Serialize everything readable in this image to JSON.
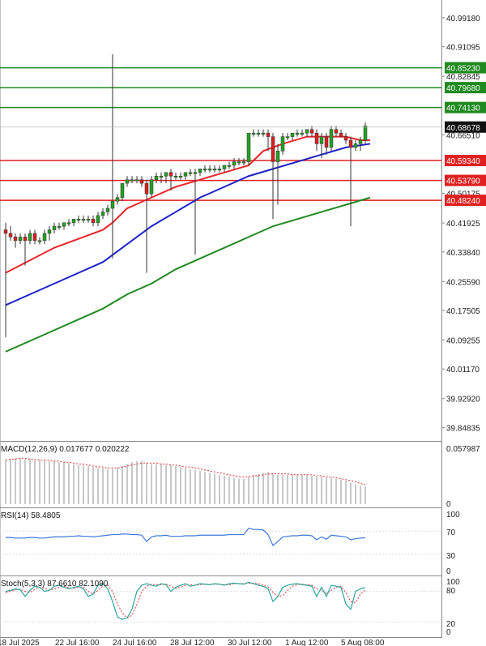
{
  "chart_data": {
    "type": "candlestick",
    "price_axis": {
      "ticks": [
        "40.99180",
        "40.91095",
        "40.82845",
        "40.66510",
        "40.50175",
        "40.41925",
        "40.33840",
        "40.25590",
        "40.17505",
        "40.09255",
        "40.01170",
        "39.92920",
        "39.84835"
      ],
      "ylim": [
        39.82,
        41.03
      ]
    },
    "current_price": "40.68678",
    "x_axis": {
      "labels": [
        "18 Jul 2025",
        "22 Jul 16:00",
        "24 Jul 16:00",
        "28 Jul 12:00",
        "30 Jul 12:00",
        "1 Aug 12:00",
        "5 Aug 08:00"
      ]
    },
    "levels": {
      "resistance": [
        40.8523,
        40.7968,
        40.7413
      ],
      "support": [
        40.5934,
        40.5379,
        40.4824
      ],
      "resistance_labels": [
        "40.85230",
        "40.79680",
        "40.74130"
      ],
      "support_labels": [
        "40.59340",
        "40.53790",
        "40.48240"
      ],
      "resistance_color": "#1f8a1f",
      "support_color": "#e02020"
    },
    "candles": [
      [
        40.4,
        40.42,
        40.1,
        40.39
      ],
      [
        40.39,
        40.41,
        40.37,
        40.38
      ],
      [
        40.38,
        40.39,
        40.35,
        40.37
      ],
      [
        40.37,
        40.39,
        40.36,
        40.38
      ],
      [
        40.38,
        40.39,
        40.3,
        40.37
      ],
      [
        40.37,
        40.4,
        40.36,
        40.39
      ],
      [
        40.39,
        40.4,
        40.36,
        40.37
      ],
      [
        40.37,
        40.38,
        40.36,
        40.37
      ],
      [
        40.37,
        40.4,
        40.36,
        40.39
      ],
      [
        40.39,
        40.41,
        40.37,
        40.4
      ],
      [
        40.4,
        40.42,
        40.39,
        40.41
      ],
      [
        40.41,
        40.42,
        40.4,
        40.41
      ],
      [
        40.41,
        40.42,
        40.4,
        40.42
      ],
      [
        40.42,
        40.43,
        40.41,
        40.42
      ],
      [
        40.42,
        40.43,
        40.41,
        40.43
      ],
      [
        40.43,
        40.44,
        40.42,
        40.43
      ],
      [
        40.43,
        40.44,
        40.42,
        40.43
      ],
      [
        40.43,
        40.44,
        40.42,
        40.43
      ],
      [
        40.43,
        40.44,
        40.41,
        40.42
      ],
      [
        40.42,
        40.45,
        40.41,
        40.44
      ],
      [
        40.44,
        40.46,
        40.43,
        40.45
      ],
      [
        40.45,
        40.47,
        40.44,
        40.46
      ],
      [
        40.46,
        40.89,
        40.32,
        40.48
      ],
      [
        40.48,
        40.5,
        40.47,
        40.49
      ],
      [
        40.49,
        40.53,
        40.48,
        40.53
      ],
      [
        40.53,
        40.55,
        40.52,
        40.54
      ],
      [
        40.54,
        40.55,
        40.53,
        40.54
      ],
      [
        40.54,
        40.55,
        40.53,
        40.54
      ],
      [
        40.54,
        40.55,
        40.52,
        40.53
      ],
      [
        40.53,
        40.54,
        40.28,
        40.5
      ],
      [
        40.5,
        40.55,
        40.49,
        40.54
      ],
      [
        40.54,
        40.56,
        40.53,
        40.55
      ],
      [
        40.55,
        40.56,
        40.53,
        40.55
      ],
      [
        40.55,
        40.56,
        40.53,
        40.56
      ],
      [
        40.56,
        40.57,
        40.51,
        40.55
      ],
      [
        40.55,
        40.56,
        40.54,
        40.55
      ],
      [
        40.55,
        40.56,
        40.54,
        40.55
      ],
      [
        40.55,
        40.56,
        40.54,
        40.56
      ],
      [
        40.56,
        40.57,
        40.55,
        40.56
      ],
      [
        40.56,
        40.57,
        40.33,
        40.56
      ],
      [
        40.56,
        40.57,
        40.55,
        40.57
      ],
      [
        40.57,
        40.58,
        40.56,
        40.57
      ],
      [
        40.57,
        40.58,
        40.56,
        40.57
      ],
      [
        40.57,
        40.58,
        40.56,
        40.57
      ],
      [
        40.57,
        40.58,
        40.56,
        40.57
      ],
      [
        40.57,
        40.58,
        40.56,
        40.58
      ],
      [
        40.58,
        40.59,
        40.57,
        40.58
      ],
      [
        40.58,
        40.6,
        40.57,
        40.59
      ],
      [
        40.59,
        40.6,
        40.58,
        40.59
      ],
      [
        40.59,
        40.6,
        40.58,
        40.59
      ],
      [
        40.59,
        40.67,
        40.58,
        40.67
      ],
      [
        40.67,
        40.68,
        40.66,
        40.67
      ],
      [
        40.67,
        40.68,
        40.66,
        40.67
      ],
      [
        40.67,
        40.68,
        40.66,
        40.67
      ],
      [
        40.67,
        40.68,
        40.62,
        40.66
      ],
      [
        40.66,
        40.67,
        40.43,
        40.59
      ],
      [
        40.59,
        40.64,
        40.47,
        40.62
      ],
      [
        40.62,
        40.67,
        40.61,
        40.66
      ],
      [
        40.66,
        40.67,
        40.65,
        40.66
      ],
      [
        40.66,
        40.67,
        40.65,
        40.67
      ],
      [
        40.67,
        40.68,
        40.66,
        40.67
      ],
      [
        40.67,
        40.68,
        40.66,
        40.67
      ],
      [
        40.67,
        40.68,
        40.66,
        40.68
      ],
      [
        40.68,
        40.69,
        40.66,
        40.67
      ],
      [
        40.67,
        40.68,
        40.62,
        40.64
      ],
      [
        40.64,
        40.67,
        40.6,
        40.66
      ],
      [
        40.66,
        40.67,
        40.61,
        40.63
      ],
      [
        40.63,
        40.69,
        40.62,
        40.68
      ],
      [
        40.68,
        40.69,
        40.66,
        40.67
      ],
      [
        40.67,
        40.68,
        40.66,
        40.66
      ],
      [
        40.66,
        40.67,
        40.64,
        40.65
      ],
      [
        40.65,
        40.66,
        40.41,
        40.63
      ],
      [
        40.63,
        40.65,
        40.62,
        40.64
      ],
      [
        40.64,
        40.66,
        40.62,
        40.65
      ],
      [
        40.65,
        40.7,
        40.64,
        40.69
      ]
    ],
    "ma_fast": {
      "color": "#e8262a",
      "points": [
        [
          0,
          40.28
        ],
        [
          10,
          40.35
        ],
        [
          20,
          40.4
        ],
        [
          22,
          40.42
        ],
        [
          25,
          40.46
        ],
        [
          30,
          40.49
        ],
        [
          35,
          40.52
        ],
        [
          40,
          40.54
        ],
        [
          45,
          40.56
        ],
        [
          50,
          40.58
        ],
        [
          53,
          40.62
        ],
        [
          57,
          40.64
        ],
        [
          62,
          40.66
        ],
        [
          66,
          40.66
        ],
        [
          70,
          40.66
        ],
        [
          73,
          40.65
        ],
        [
          75,
          40.65
        ]
      ]
    },
    "ma_mid": {
      "color": "#1c22c8",
      "points": [
        [
          0,
          40.19
        ],
        [
          5,
          40.22
        ],
        [
          10,
          40.25
        ],
        [
          15,
          40.28
        ],
        [
          20,
          40.31
        ],
        [
          25,
          40.36
        ],
        [
          30,
          40.41
        ],
        [
          35,
          40.45
        ],
        [
          40,
          40.49
        ],
        [
          45,
          40.52
        ],
        [
          50,
          40.55
        ],
        [
          55,
          40.57
        ],
        [
          60,
          40.59
        ],
        [
          65,
          40.61
        ],
        [
          70,
          40.63
        ],
        [
          75,
          40.64
        ]
      ]
    },
    "ma_slow": {
      "color": "#1f8a1f",
      "points": [
        [
          0,
          40.06
        ],
        [
          5,
          40.09
        ],
        [
          10,
          40.12
        ],
        [
          15,
          40.15
        ],
        [
          20,
          40.18
        ],
        [
          25,
          40.22
        ],
        [
          30,
          40.25
        ],
        [
          35,
          40.29
        ],
        [
          40,
          40.32
        ],
        [
          45,
          40.35
        ],
        [
          50,
          40.38
        ],
        [
          55,
          40.41
        ],
        [
          60,
          40.43
        ],
        [
          65,
          40.45
        ],
        [
          70,
          40.47
        ],
        [
          75,
          40.49
        ]
      ]
    },
    "macd": {
      "label": "MACD(12,26,9) 0.017677 0.020222",
      "axis_labels": [
        "0.057987",
        "0"
      ],
      "max": 0.058,
      "histogram": [
        0.045,
        0.046,
        0.047,
        0.047,
        0.046,
        0.046,
        0.045,
        0.045,
        0.045,
        0.044,
        0.044,
        0.043,
        0.043,
        0.042,
        0.041,
        0.04,
        0.04,
        0.039,
        0.038,
        0.037,
        0.037,
        0.036,
        0.036,
        0.037,
        0.039,
        0.041,
        0.043,
        0.044,
        0.044,
        0.042,
        0.041,
        0.041,
        0.041,
        0.04,
        0.04,
        0.039,
        0.038,
        0.037,
        0.036,
        0.035,
        0.034,
        0.033,
        0.032,
        0.031,
        0.03,
        0.029,
        0.028,
        0.027,
        0.026,
        0.026,
        0.028,
        0.03,
        0.031,
        0.032,
        0.033,
        0.031,
        0.03,
        0.03,
        0.03,
        0.03,
        0.03,
        0.03,
        0.03,
        0.029,
        0.028,
        0.028,
        0.027,
        0.027,
        0.026,
        0.025,
        0.024,
        0.022,
        0.02,
        0.019,
        0.018
      ],
      "signal": [
        0.045,
        0.046,
        0.046,
        0.047,
        0.047,
        0.046,
        0.046,
        0.045,
        0.045,
        0.045,
        0.044,
        0.044,
        0.043,
        0.043,
        0.042,
        0.041,
        0.041,
        0.04,
        0.039,
        0.038,
        0.038,
        0.037,
        0.037,
        0.037,
        0.038,
        0.039,
        0.04,
        0.041,
        0.042,
        0.042,
        0.042,
        0.042,
        0.041,
        0.041,
        0.04,
        0.04,
        0.039,
        0.038,
        0.038,
        0.037,
        0.036,
        0.035,
        0.034,
        0.033,
        0.032,
        0.031,
        0.03,
        0.029,
        0.028,
        0.028,
        0.028,
        0.029,
        0.029,
        0.03,
        0.031,
        0.031,
        0.031,
        0.031,
        0.031,
        0.03,
        0.03,
        0.03,
        0.03,
        0.03,
        0.029,
        0.029,
        0.028,
        0.028,
        0.027,
        0.026,
        0.025,
        0.024,
        0.023,
        0.021,
        0.02
      ]
    },
    "rsi": {
      "label": "RSI(14) 58.4805",
      "axis_labels": [
        "100",
        "70",
        "30",
        "0"
      ],
      "color": "#3a78d8",
      "values": [
        59,
        59,
        58,
        58,
        58,
        59,
        59,
        58,
        58,
        59,
        60,
        60,
        60,
        61,
        61,
        62,
        61,
        61,
        60,
        61,
        62,
        63,
        64,
        64,
        65,
        65,
        64,
        64,
        63,
        52,
        60,
        62,
        62,
        63,
        61,
        61,
        61,
        62,
        62,
        62,
        63,
        63,
        63,
        63,
        63,
        63,
        64,
        64,
        64,
        64,
        75,
        73,
        73,
        72,
        64,
        45,
        52,
        60,
        61,
        62,
        62,
        63,
        63,
        62,
        55,
        60,
        56,
        63,
        62,
        61,
        60,
        55,
        57,
        58,
        58.5
      ]
    },
    "stoch": {
      "label": "Stoch(5,3,3) 87.6610 82.1090",
      "axis_labels": [
        "100",
        "80",
        "20",
        "0"
      ],
      "k_color": "#2aa6a0",
      "d_color": "#e03030",
      "k": [
        80,
        82,
        85,
        83,
        70,
        82,
        90,
        88,
        80,
        82,
        90,
        92,
        88,
        85,
        88,
        90,
        85,
        70,
        75,
        92,
        95,
        85,
        60,
        30,
        25,
        28,
        45,
        80,
        92,
        95,
        92,
        90,
        95,
        93,
        80,
        88,
        92,
        95,
        90,
        92,
        95,
        94,
        93,
        95,
        94,
        92,
        95,
        96,
        95,
        94,
        98,
        95,
        92,
        90,
        85,
        60,
        70,
        88,
        92,
        94,
        95,
        93,
        92,
        90,
        70,
        88,
        70,
        92,
        90,
        88,
        55,
        45,
        80,
        85,
        87.661
      ],
      "d": [
        78,
        80,
        83,
        84,
        80,
        78,
        84,
        88,
        86,
        82,
        85,
        88,
        90,
        87,
        86,
        88,
        88,
        80,
        75,
        82,
        90,
        92,
        80,
        55,
        38,
        28,
        33,
        55,
        80,
        90,
        94,
        93,
        93,
        94,
        90,
        86,
        88,
        92,
        93,
        92,
        93,
        94,
        94,
        94,
        94,
        93,
        93,
        95,
        95,
        95,
        96,
        96,
        95,
        92,
        89,
        78,
        70,
        72,
        82,
        90,
        93,
        94,
        93,
        92,
        85,
        82,
        76,
        82,
        88,
        90,
        78,
        60,
        58,
        75,
        82.109
      ]
    }
  }
}
